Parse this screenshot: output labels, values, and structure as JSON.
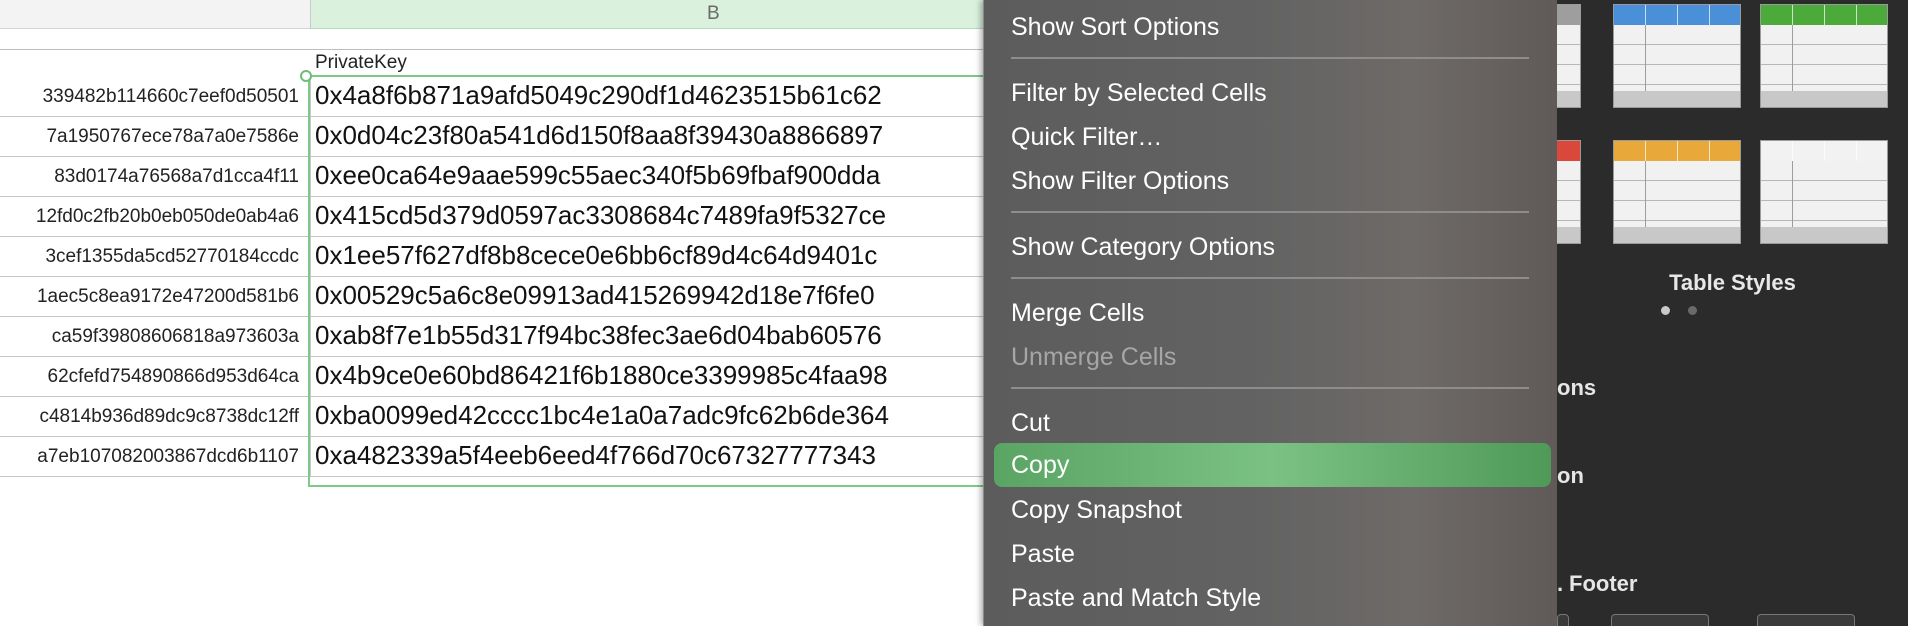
{
  "spreadsheet": {
    "column_b_header": "B",
    "header_label": "PrivateKey",
    "rows": [
      {
        "a": "339482b114660c7eef0d50501",
        "b": "0x4a8f6b871a9afd5049c290df1d4623515b61c62"
      },
      {
        "a": "7a1950767ece78a7a0e7586e",
        "b": "0x0d04c23f80a541d6d150f8aa8f39430a8866897"
      },
      {
        "a": "83d0174a76568a7d1cca4f11",
        "b": "0xee0ca64e9aae599c55aec340f5b69fbaf900dda"
      },
      {
        "a": "12fd0c2fb20b0eb050de0ab4a6",
        "b": "0x415cd5d379d0597ac3308684c7489fa9f5327ce"
      },
      {
        "a": "3cef1355da5cd52770184ccdc",
        "b": "0x1ee57f627df8b8cece0e6bb6cf89d4c64d9401c"
      },
      {
        "a": "1aec5c8ea9172e47200d581b6",
        "b": "0x00529c5a6c8e09913ad415269942d18e7f6fe0"
      },
      {
        "a": "ca59f39808606818a973603a",
        "b": "0xab8f7e1b55d317f94bc38fec3ae6d04bab60576"
      },
      {
        "a": "62cfefd754890866d953d64ca",
        "b": "0x4b9ce0e60bd86421f6b1880ce3399985c4faa98"
      },
      {
        "a": "c4814b936d89dc9c8738dc12ff",
        "b": "0xba0099ed42cccc1bc4e1a0a7adc9fc62b6de364"
      },
      {
        "a": "a7eb107082003867dcd6b1107",
        "b": "0xa482339a5f4eeb6eed4f766d70c67327777343"
      }
    ]
  },
  "context_menu": {
    "show_sort_options": "Show Sort Options",
    "filter_by_selected_cells": "Filter by Selected Cells",
    "quick_filter": "Quick Filter…",
    "show_filter_options": "Show Filter Options",
    "show_category_options": "Show Category Options",
    "merge_cells": "Merge Cells",
    "unmerge_cells": "Unmerge Cells",
    "cut": "Cut",
    "copy": "Copy",
    "copy_snapshot": "Copy Snapshot",
    "paste": "Paste",
    "paste_and_match_style": "Paste and Match Style"
  },
  "format_panel": {
    "title": "Table Styles",
    "style_colors": [
      "#9e9e9e",
      "#4a90d9",
      "#4caa3a",
      "#d9483b",
      "#e8a83a",
      "#f2f2f2"
    ],
    "fragment_options": "ons",
    "fragment_on": "on",
    "fragment_footer": "Footer",
    "page_dots": [
      "active",
      "inactive"
    ],
    "colors": {
      "menu_highlight": "#6db677",
      "selection": "#7ec987",
      "panel_bg": "#2b2b2b"
    }
  }
}
